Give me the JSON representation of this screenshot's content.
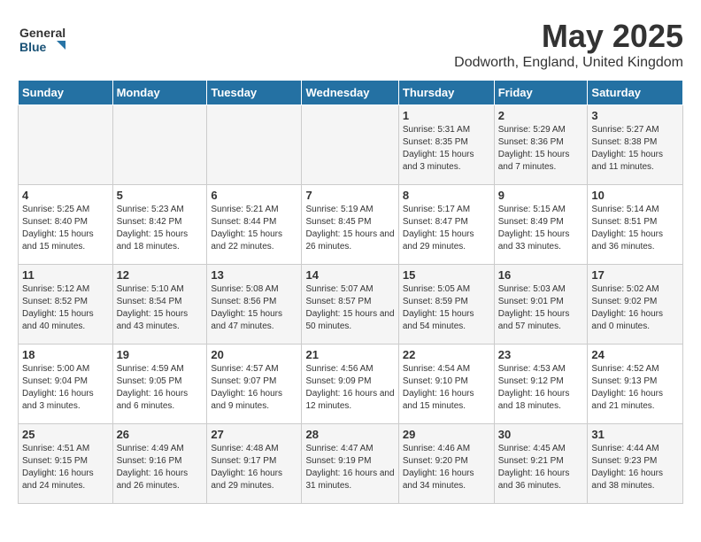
{
  "header": {
    "logo_general": "General",
    "logo_blue": "Blue",
    "title": "May 2025",
    "subtitle": "Dodworth, England, United Kingdom"
  },
  "days_of_week": [
    "Sunday",
    "Monday",
    "Tuesday",
    "Wednesday",
    "Thursday",
    "Friday",
    "Saturday"
  ],
  "weeks": [
    {
      "days": [
        {
          "num": "",
          "sunrise": "",
          "sunset": "",
          "daylight": ""
        },
        {
          "num": "",
          "sunrise": "",
          "sunset": "",
          "daylight": ""
        },
        {
          "num": "",
          "sunrise": "",
          "sunset": "",
          "daylight": ""
        },
        {
          "num": "",
          "sunrise": "",
          "sunset": "",
          "daylight": ""
        },
        {
          "num": "1",
          "sunrise": "Sunrise: 5:31 AM",
          "sunset": "Sunset: 8:35 PM",
          "daylight": "Daylight: 15 hours and 3 minutes."
        },
        {
          "num": "2",
          "sunrise": "Sunrise: 5:29 AM",
          "sunset": "Sunset: 8:36 PM",
          "daylight": "Daylight: 15 hours and 7 minutes."
        },
        {
          "num": "3",
          "sunrise": "Sunrise: 5:27 AM",
          "sunset": "Sunset: 8:38 PM",
          "daylight": "Daylight: 15 hours and 11 minutes."
        }
      ]
    },
    {
      "days": [
        {
          "num": "4",
          "sunrise": "Sunrise: 5:25 AM",
          "sunset": "Sunset: 8:40 PM",
          "daylight": "Daylight: 15 hours and 15 minutes."
        },
        {
          "num": "5",
          "sunrise": "Sunrise: 5:23 AM",
          "sunset": "Sunset: 8:42 PM",
          "daylight": "Daylight: 15 hours and 18 minutes."
        },
        {
          "num": "6",
          "sunrise": "Sunrise: 5:21 AM",
          "sunset": "Sunset: 8:44 PM",
          "daylight": "Daylight: 15 hours and 22 minutes."
        },
        {
          "num": "7",
          "sunrise": "Sunrise: 5:19 AM",
          "sunset": "Sunset: 8:45 PM",
          "daylight": "Daylight: 15 hours and 26 minutes."
        },
        {
          "num": "8",
          "sunrise": "Sunrise: 5:17 AM",
          "sunset": "Sunset: 8:47 PM",
          "daylight": "Daylight: 15 hours and 29 minutes."
        },
        {
          "num": "9",
          "sunrise": "Sunrise: 5:15 AM",
          "sunset": "Sunset: 8:49 PM",
          "daylight": "Daylight: 15 hours and 33 minutes."
        },
        {
          "num": "10",
          "sunrise": "Sunrise: 5:14 AM",
          "sunset": "Sunset: 8:51 PM",
          "daylight": "Daylight: 15 hours and 36 minutes."
        }
      ]
    },
    {
      "days": [
        {
          "num": "11",
          "sunrise": "Sunrise: 5:12 AM",
          "sunset": "Sunset: 8:52 PM",
          "daylight": "Daylight: 15 hours and 40 minutes."
        },
        {
          "num": "12",
          "sunrise": "Sunrise: 5:10 AM",
          "sunset": "Sunset: 8:54 PM",
          "daylight": "Daylight: 15 hours and 43 minutes."
        },
        {
          "num": "13",
          "sunrise": "Sunrise: 5:08 AM",
          "sunset": "Sunset: 8:56 PM",
          "daylight": "Daylight: 15 hours and 47 minutes."
        },
        {
          "num": "14",
          "sunrise": "Sunrise: 5:07 AM",
          "sunset": "Sunset: 8:57 PM",
          "daylight": "Daylight: 15 hours and 50 minutes."
        },
        {
          "num": "15",
          "sunrise": "Sunrise: 5:05 AM",
          "sunset": "Sunset: 8:59 PM",
          "daylight": "Daylight: 15 hours and 54 minutes."
        },
        {
          "num": "16",
          "sunrise": "Sunrise: 5:03 AM",
          "sunset": "Sunset: 9:01 PM",
          "daylight": "Daylight: 15 hours and 57 minutes."
        },
        {
          "num": "17",
          "sunrise": "Sunrise: 5:02 AM",
          "sunset": "Sunset: 9:02 PM",
          "daylight": "Daylight: 16 hours and 0 minutes."
        }
      ]
    },
    {
      "days": [
        {
          "num": "18",
          "sunrise": "Sunrise: 5:00 AM",
          "sunset": "Sunset: 9:04 PM",
          "daylight": "Daylight: 16 hours and 3 minutes."
        },
        {
          "num": "19",
          "sunrise": "Sunrise: 4:59 AM",
          "sunset": "Sunset: 9:05 PM",
          "daylight": "Daylight: 16 hours and 6 minutes."
        },
        {
          "num": "20",
          "sunrise": "Sunrise: 4:57 AM",
          "sunset": "Sunset: 9:07 PM",
          "daylight": "Daylight: 16 hours and 9 minutes."
        },
        {
          "num": "21",
          "sunrise": "Sunrise: 4:56 AM",
          "sunset": "Sunset: 9:09 PM",
          "daylight": "Daylight: 16 hours and 12 minutes."
        },
        {
          "num": "22",
          "sunrise": "Sunrise: 4:54 AM",
          "sunset": "Sunset: 9:10 PM",
          "daylight": "Daylight: 16 hours and 15 minutes."
        },
        {
          "num": "23",
          "sunrise": "Sunrise: 4:53 AM",
          "sunset": "Sunset: 9:12 PM",
          "daylight": "Daylight: 16 hours and 18 minutes."
        },
        {
          "num": "24",
          "sunrise": "Sunrise: 4:52 AM",
          "sunset": "Sunset: 9:13 PM",
          "daylight": "Daylight: 16 hours and 21 minutes."
        }
      ]
    },
    {
      "days": [
        {
          "num": "25",
          "sunrise": "Sunrise: 4:51 AM",
          "sunset": "Sunset: 9:15 PM",
          "daylight": "Daylight: 16 hours and 24 minutes."
        },
        {
          "num": "26",
          "sunrise": "Sunrise: 4:49 AM",
          "sunset": "Sunset: 9:16 PM",
          "daylight": "Daylight: 16 hours and 26 minutes."
        },
        {
          "num": "27",
          "sunrise": "Sunrise: 4:48 AM",
          "sunset": "Sunset: 9:17 PM",
          "daylight": "Daylight: 16 hours and 29 minutes."
        },
        {
          "num": "28",
          "sunrise": "Sunrise: 4:47 AM",
          "sunset": "Sunset: 9:19 PM",
          "daylight": "Daylight: 16 hours and 31 minutes."
        },
        {
          "num": "29",
          "sunrise": "Sunrise: 4:46 AM",
          "sunset": "Sunset: 9:20 PM",
          "daylight": "Daylight: 16 hours and 34 minutes."
        },
        {
          "num": "30",
          "sunrise": "Sunrise: 4:45 AM",
          "sunset": "Sunset: 9:21 PM",
          "daylight": "Daylight: 16 hours and 36 minutes."
        },
        {
          "num": "31",
          "sunrise": "Sunrise: 4:44 AM",
          "sunset": "Sunset: 9:23 PM",
          "daylight": "Daylight: 16 hours and 38 minutes."
        }
      ]
    }
  ]
}
